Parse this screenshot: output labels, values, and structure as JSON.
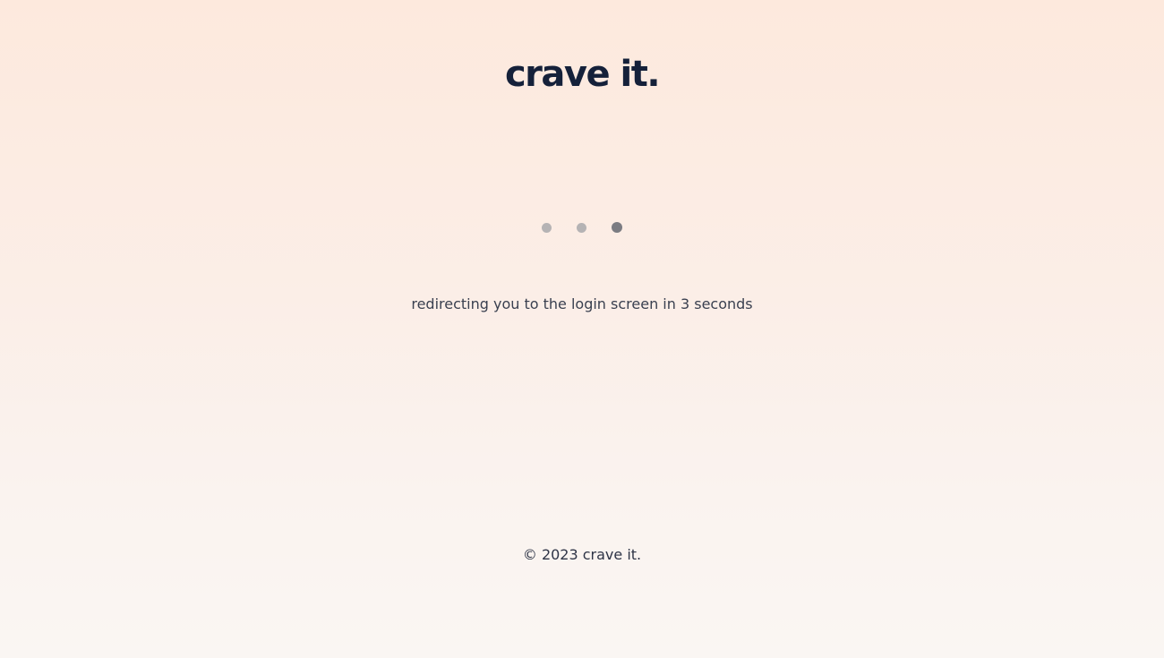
{
  "brand": {
    "logo_text": "crave it."
  },
  "loader": {
    "dots": 3,
    "active_dot": 3,
    "dot_color": "#b5b3b4",
    "active_dot_color": "#7b7c82"
  },
  "status": {
    "message": "redirecting you to the login screen in 3 seconds"
  },
  "footer": {
    "copyright": "© 2023 crave it."
  },
  "colors": {
    "brand_text": "#15213a",
    "background_top": "#fde9dd",
    "background_bottom": "#faf6f3"
  }
}
